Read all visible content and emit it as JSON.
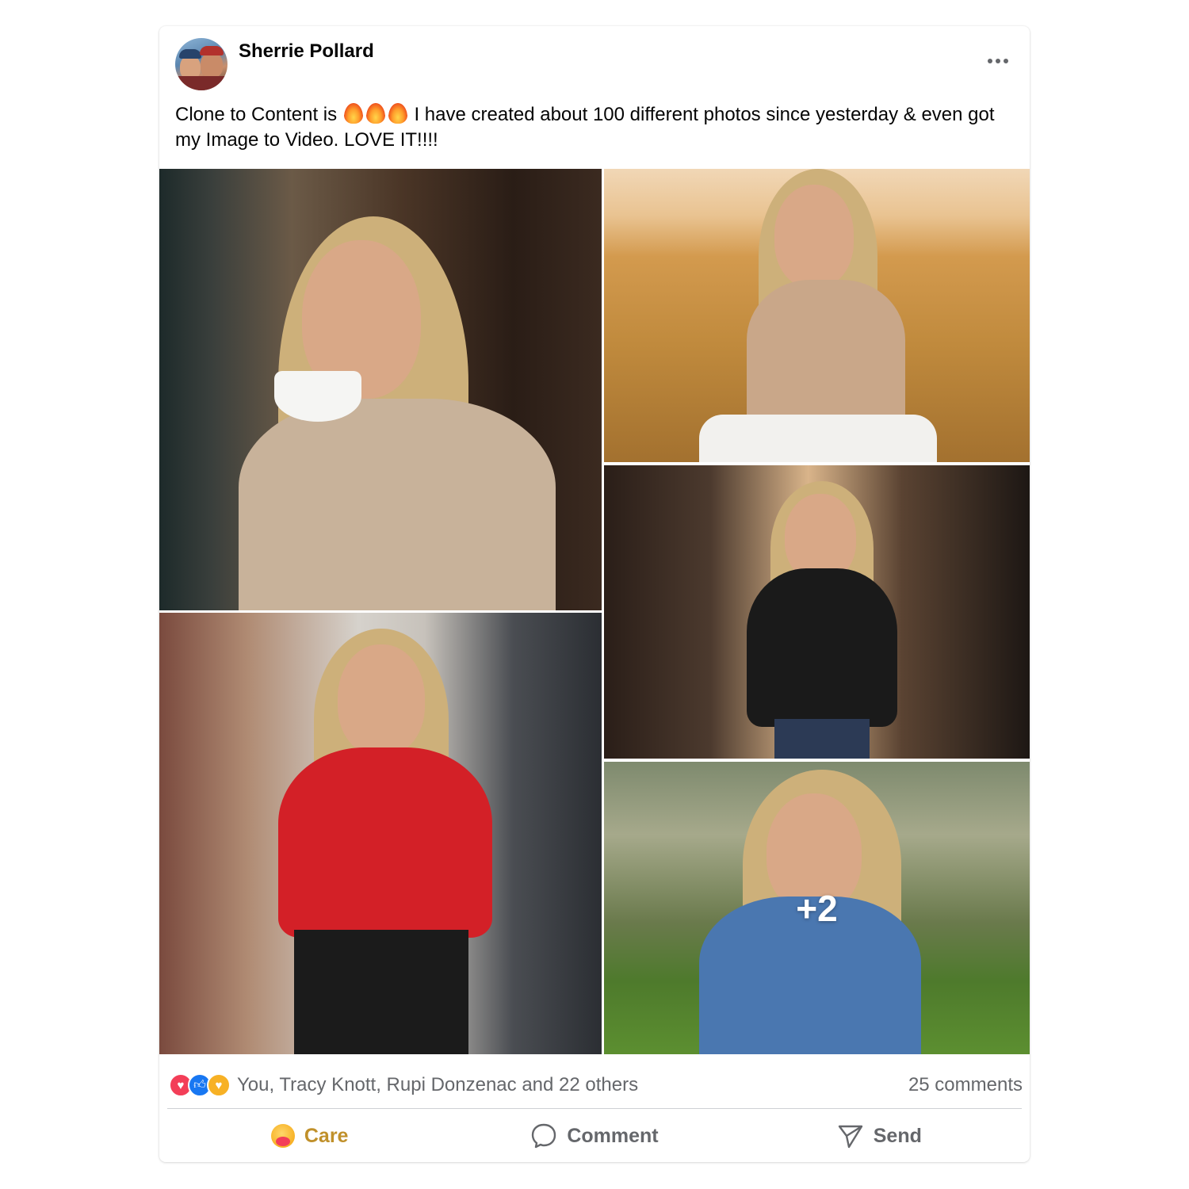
{
  "post": {
    "author": "Sherrie Pollard",
    "text_before": "Clone to Content is",
    "fire_count": 3,
    "text_after": "I have created about 100 different photos since yesterday & even got my Image to Video. LOVE IT!!!!",
    "more_photos_label": "+2"
  },
  "reactions": {
    "icons": [
      "love-icon",
      "like-icon",
      "care-icon"
    ],
    "summary": "You, Tracy Knott, Rupi Donzenac and 22 others",
    "comments": "25 comments"
  },
  "actions": {
    "care": "Care",
    "comment": "Comment",
    "send": "Send"
  },
  "colors": {
    "primary_text": "#050505",
    "secondary_text": "#65676b",
    "love": "#f33e58",
    "like": "#1877f2",
    "care": "#f7b125"
  }
}
